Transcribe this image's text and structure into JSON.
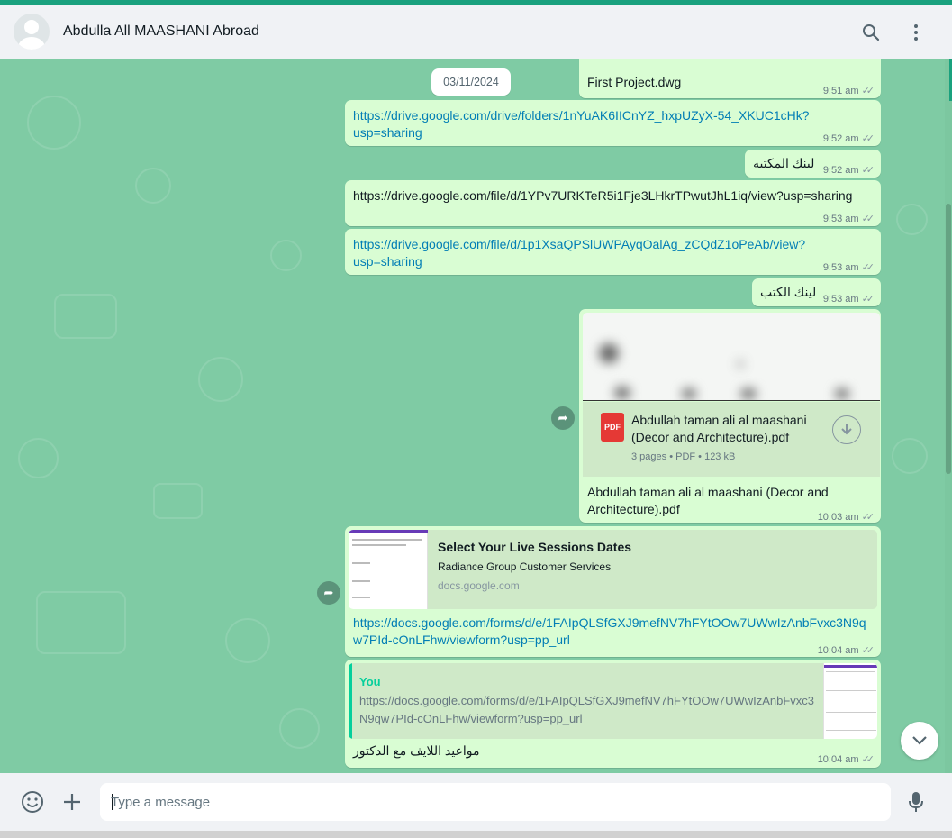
{
  "header": {
    "contact_name": "Abdulla All MAASHANI Abroad",
    "icons": {
      "avatar": "default-avatar-icon",
      "search": "search-icon",
      "menu": "kebab-menu-icon"
    }
  },
  "date_chip": "03/11/2024",
  "messages": [
    {
      "text": "First Project.dwg",
      "time": "9:51 am"
    },
    {
      "text": "https://drive.google.com/drive/folders/1nYuAK6IICnYZ_hxpUZyX-54_XKUC1cHk?usp=sharing",
      "line1": "https://drive.google.com/drive/folders/1nYuAK6IICnYZ_hxpUZyX-54_XKUC1cHk?",
      "line2": "usp=sharing",
      "time": "9:52 am"
    },
    {
      "text": "لينك المكتبه",
      "time": "9:52 am"
    },
    {
      "text": "https://drive.google.com/file/d/1YPv7URKTeR5i1Fje3LHkrTPwutJhL1iq/view?usp=sharing",
      "time": "9:53 am"
    },
    {
      "text": "https://drive.google.com/file/d/1p1XsaQPSlUWPAyqOalAg_zCQdZ1oPeAb/view?usp=sharing",
      "line1": "https://drive.google.com/file/d/1p1XsaQPSlUWPAyqOalAg_zCQdZ1oPeAb/view?",
      "line2": "usp=sharing",
      "time": "9:53 am"
    },
    {
      "text": "لينك الكتب",
      "time": "9:53 am"
    },
    {
      "document": {
        "title": "Abdullah taman ali al maashani (Decor and Architecture).pdf",
        "pdf_label": "PDF",
        "meta": "3 pages • PDF • 123 kB"
      },
      "caption": "Abdullah taman ali al maashani (Decor and Architecture).pdf",
      "time": "10:03 am"
    },
    {
      "link_preview": {
        "title": "Select Your Live Sessions Dates",
        "description": "Radiance Group Customer Services",
        "domain": "docs.google.com"
      },
      "line1": "https://docs.google.com/forms/d/e/1FAIpQLSfGXJ9mefNV7hFYtOOw7UWwIzAnbFvxc3N9q",
      "line2": "w7PId-cOnLFhw/viewform?usp=pp_url",
      "time": "10:04 am"
    },
    {
      "quote": {
        "author": "You",
        "text": "https://docs.google.com/forms/d/e/1FAIpQLSfGXJ9mefNV7hFYtOOw7UWwIzAnbFvxc3N9qw7PId-cOnLFhw/viewform?usp=pp_url"
      },
      "text": "مواعيد اللايف مع الدكتور",
      "time": "10:04 am"
    }
  ],
  "ticks": "✓✓",
  "footer": {
    "placeholder": "Type a message",
    "icons": {
      "emoji": "emoji-icon",
      "attach": "plus-icon",
      "mic": "microphone-icon"
    }
  },
  "scroll_down_icon": "chevron-down-icon",
  "forward_icon": "forward-icon",
  "colors": {
    "chat_bg": "#7fcba4",
    "outgoing_bubble": "#d9fdd3",
    "link": "#027eb5",
    "accent": "#06cf9c",
    "header_bg": "#f0f2f5"
  }
}
